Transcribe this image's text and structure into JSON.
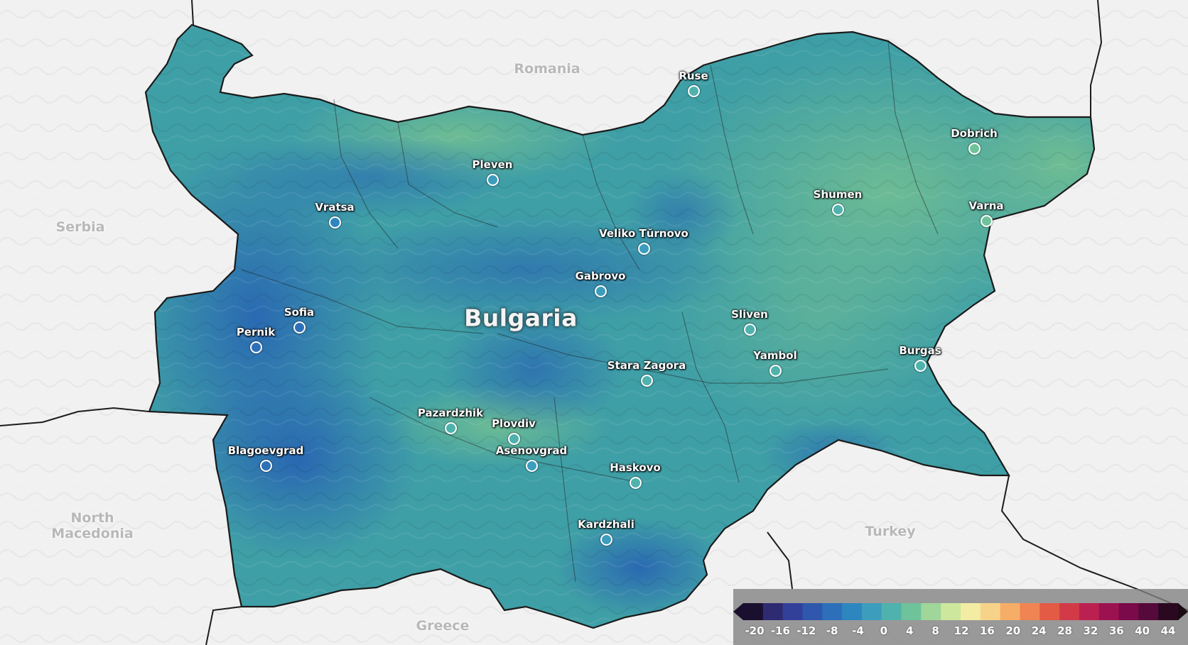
{
  "map": {
    "country_labels": {
      "serbia": "Serbia",
      "romania": "Romania",
      "north_macedonia": "North Macedonia",
      "greece": "Greece",
      "turkey": "Turkey"
    },
    "main_label": "Bulgaria",
    "cities": [
      {
        "key": "ruse",
        "name": "Ruse",
        "value": 2
      },
      {
        "key": "dobrich",
        "name": "Dobrich",
        "value": 4
      },
      {
        "key": "pleven",
        "name": "Pleven",
        "value": 0
      },
      {
        "key": "vratsa",
        "name": "Vratsa",
        "value": -4
      },
      {
        "key": "shumen",
        "name": "Shumen",
        "value": 2
      },
      {
        "key": "varna",
        "name": "Varna",
        "value": 4
      },
      {
        "key": "veliko-turnovo",
        "name": "Veliko Tŭrnovo",
        "value": 0
      },
      {
        "key": "gabrovo",
        "name": "Gabrovo",
        "value": -2
      },
      {
        "key": "sofia",
        "name": "Sofia",
        "value": -6
      },
      {
        "key": "pernik",
        "name": "Pernik",
        "value": -6
      },
      {
        "key": "sliven",
        "name": "Sliven",
        "value": 2
      },
      {
        "key": "yambol",
        "name": "Yambol",
        "value": 2
      },
      {
        "key": "burgas",
        "name": "Burgas",
        "value": 2
      },
      {
        "key": "stara-zagora",
        "name": "Stara Zagora",
        "value": 2
      },
      {
        "key": "pazardzhik",
        "name": "Pazardzhik",
        "value": 2
      },
      {
        "key": "plovdiv",
        "name": "Plovdiv",
        "value": 2
      },
      {
        "key": "asenovgrad",
        "name": "Asenovgrad",
        "value": 0
      },
      {
        "key": "blagoevgrad",
        "name": "Blagoevgrad",
        "value": -6
      },
      {
        "key": "haskovo",
        "name": "Haskovo",
        "value": 2
      },
      {
        "key": "kardzhali",
        "name": "Kardzhali",
        "value": -2
      }
    ]
  },
  "legend": {
    "ticks": [
      "-20",
      "-16",
      "-12",
      "-8",
      "-4",
      "0",
      "4",
      "8",
      "12",
      "16",
      "20",
      "24",
      "28",
      "32",
      "36",
      "40",
      "44"
    ],
    "colors": [
      "#1a0f2e",
      "#2e2b72",
      "#33409a",
      "#2f57ad",
      "#2d6fb8",
      "#2e86bf",
      "#3c9dbd",
      "#4fb2ad",
      "#6fc39a",
      "#9fd699",
      "#cde79d",
      "#f2eda3",
      "#f7d38a",
      "#f6ad68",
      "#f08453",
      "#e35a45",
      "#d23a48",
      "#bb2150",
      "#9c1250",
      "#7a0a4a",
      "#560a3c",
      "#2a0820"
    ]
  }
}
